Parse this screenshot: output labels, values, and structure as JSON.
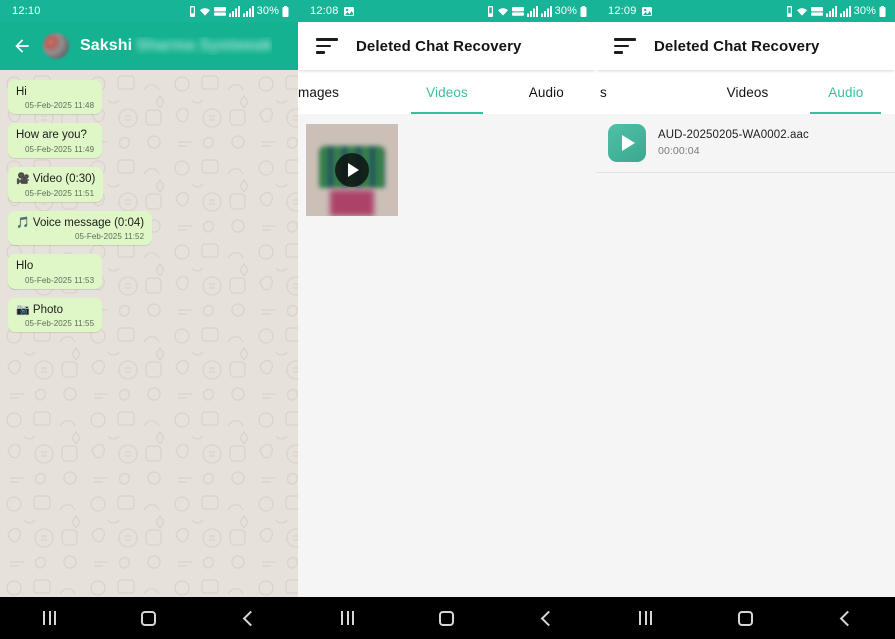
{
  "panel1": {
    "status": {
      "time": "12:10",
      "battery_pct": "30%",
      "icons": [
        "vibrate-icon",
        "wifi-icon",
        "lte-data-icon",
        "signal-bars-icon",
        "signal-bars-icon",
        "battery-icon"
      ]
    },
    "header": {
      "back": "back-arrow-icon",
      "avatar": "contact-avatar",
      "name": "Sakshi",
      "name_redacted": "Sharma Systweak"
    },
    "messages": [
      {
        "text": "Hi",
        "time": "05-Feb-2025 11:48",
        "emoji": "",
        "time_align": "left"
      },
      {
        "text": "How are you?",
        "time": "05-Feb-2025 11:49",
        "emoji": "",
        "time_align": "left"
      },
      {
        "text": "Video (0:30)",
        "time": "05-Feb-2025 11:51",
        "emoji": "🎥",
        "time_align": "left"
      },
      {
        "text": "Voice message (0:04)",
        "time": "05-Feb-2025 11:52",
        "emoji": "🎵",
        "time_align": "right"
      },
      {
        "text": "Hlo",
        "time": "05-Feb-2025 11:53",
        "emoji": "",
        "time_align": "left"
      },
      {
        "text": "Photo",
        "time": "05-Feb-2025 11:55",
        "emoji": "📷",
        "time_align": "left"
      }
    ]
  },
  "panel2": {
    "status": {
      "time": "12:08",
      "battery_pct": "30%"
    },
    "appbar": {
      "menu_icon": "sort-menu-icon",
      "title": "Deleted Chat Recovery"
    },
    "tabs": [
      {
        "label": "mages",
        "active": false
      },
      {
        "label": "Videos",
        "active": true
      },
      {
        "label": "Audio",
        "active": false
      }
    ],
    "videos": [
      {
        "name": "video-thumbnail",
        "play": "play-icon"
      }
    ]
  },
  "panel3": {
    "status": {
      "time": "12:09",
      "battery_pct": "30%"
    },
    "appbar": {
      "menu_icon": "sort-menu-icon",
      "title": "Deleted Chat Recovery"
    },
    "tabs": [
      {
        "label": "s",
        "active": false
      },
      {
        "label": "Videos",
        "active": false
      },
      {
        "label": "Audio",
        "active": true
      }
    ],
    "audio": [
      {
        "filename": "AUD-20250205-WA0002.aac",
        "duration": "00:00:04"
      }
    ]
  },
  "navbar": {
    "recents": "recents-icon",
    "home": "home-icon",
    "back": "back-icon"
  },
  "colors": {
    "whatsapp_teal": "#14b291",
    "status_teal": "#17b497",
    "accent_teal": "#35c0a0",
    "bubble_green": "#dff7c6",
    "chat_bg": "#e6e1da",
    "content_bg": "#f5f5f5",
    "navbar_bg": "#000000"
  }
}
